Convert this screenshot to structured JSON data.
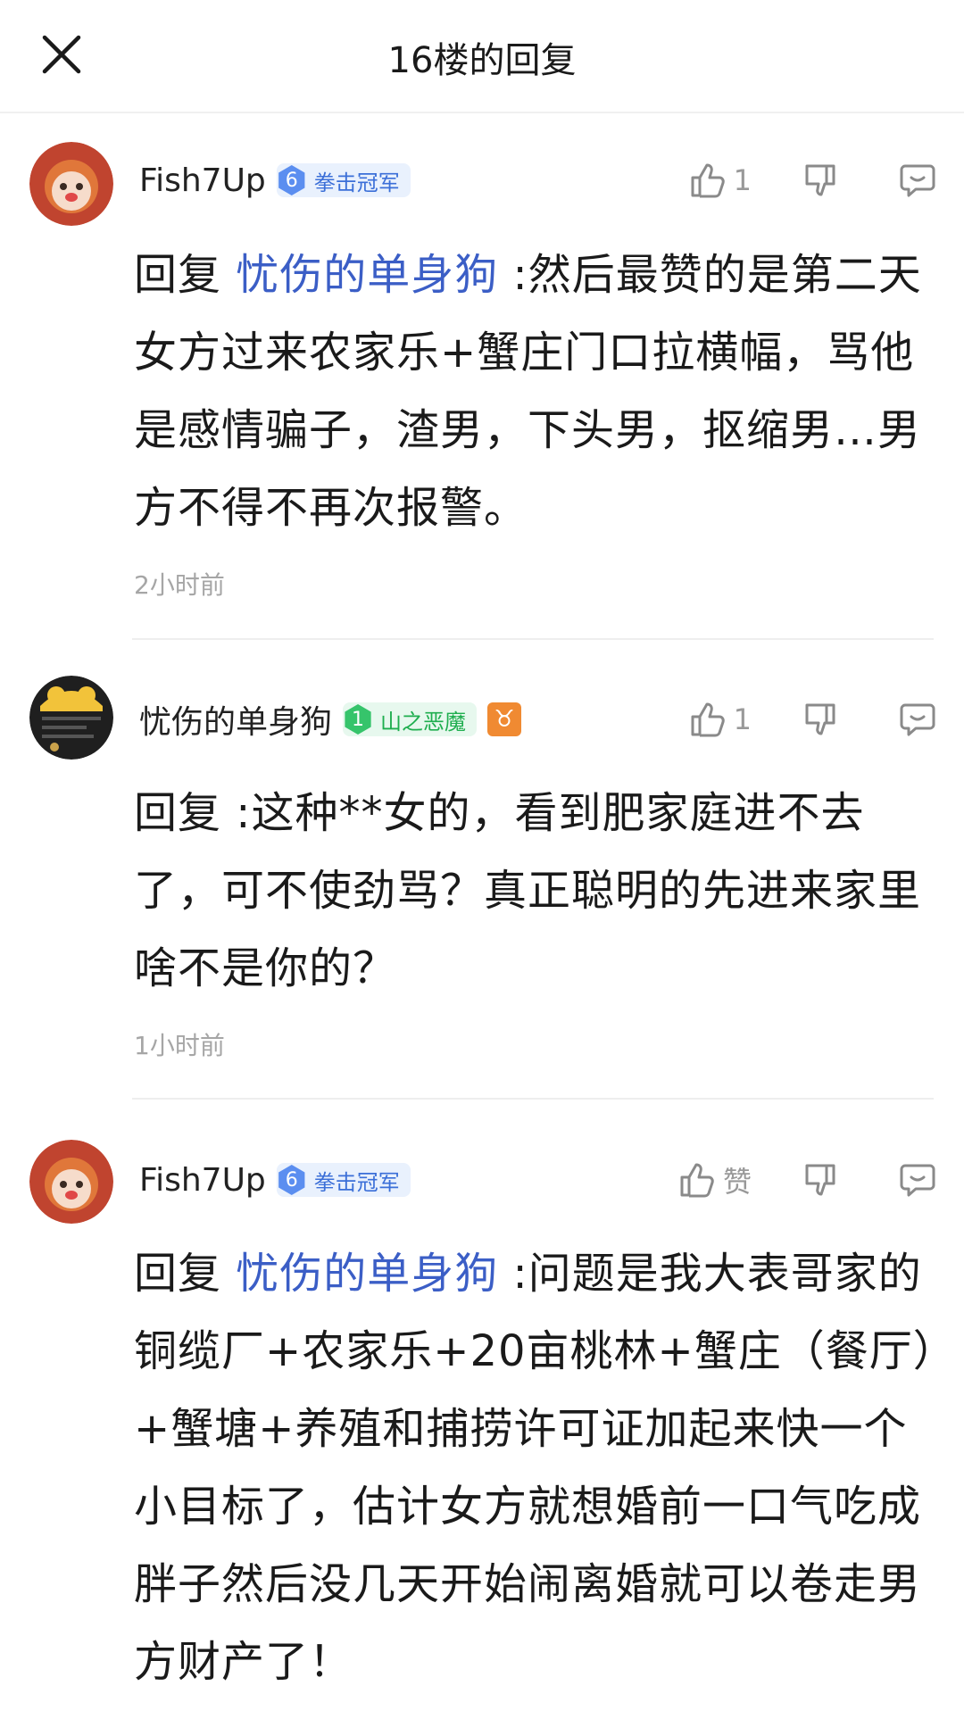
{
  "header": {
    "title": "16楼的回复",
    "close_icon": "close-icon"
  },
  "comments": [
    {
      "username": "Fish7Up",
      "badge_level": "6",
      "badge_text": "拳击冠军",
      "badge_color": "#3b6fd8",
      "like_count": "1",
      "reply_prefix": "回复",
      "mention": "忧伤的单身狗",
      "text": " :然后最赞的是第二天女方过来农家乐+蟹庄门口拉横幅，骂他是感情骗子，渣男，下头男，抠缩男…男方不得不再次报警。",
      "time": "2小时前"
    },
    {
      "username": "忧伤的单身狗",
      "badge_level": "1",
      "badge_text": "山之恶魔",
      "badge_color": "#1fae4f",
      "zodiac": "♉",
      "like_count": "1",
      "reply_prefix": "回复",
      "mention": "",
      "text": "  :这种**女的，看到肥家庭进不去了，可不使劲骂？真正聪明的先进来家里啥不是你的？",
      "time": "1小时前"
    },
    {
      "username": "Fish7Up",
      "badge_level": "6",
      "badge_text": "拳击冠军",
      "badge_color": "#3b6fd8",
      "like_label": "赞",
      "reply_prefix": "回复",
      "mention": "忧伤的单身狗",
      "text": " :问题是我大表哥家的铜缆厂+农家乐+20亩桃林+蟹庄（餐厅）+蟹塘+养殖和捕捞许可证加起来快一个小目标了，估计女方就想婚前一口气吃成胖子然后没几天开始闹离婚就可以卷走男方财产了！"
    }
  ]
}
